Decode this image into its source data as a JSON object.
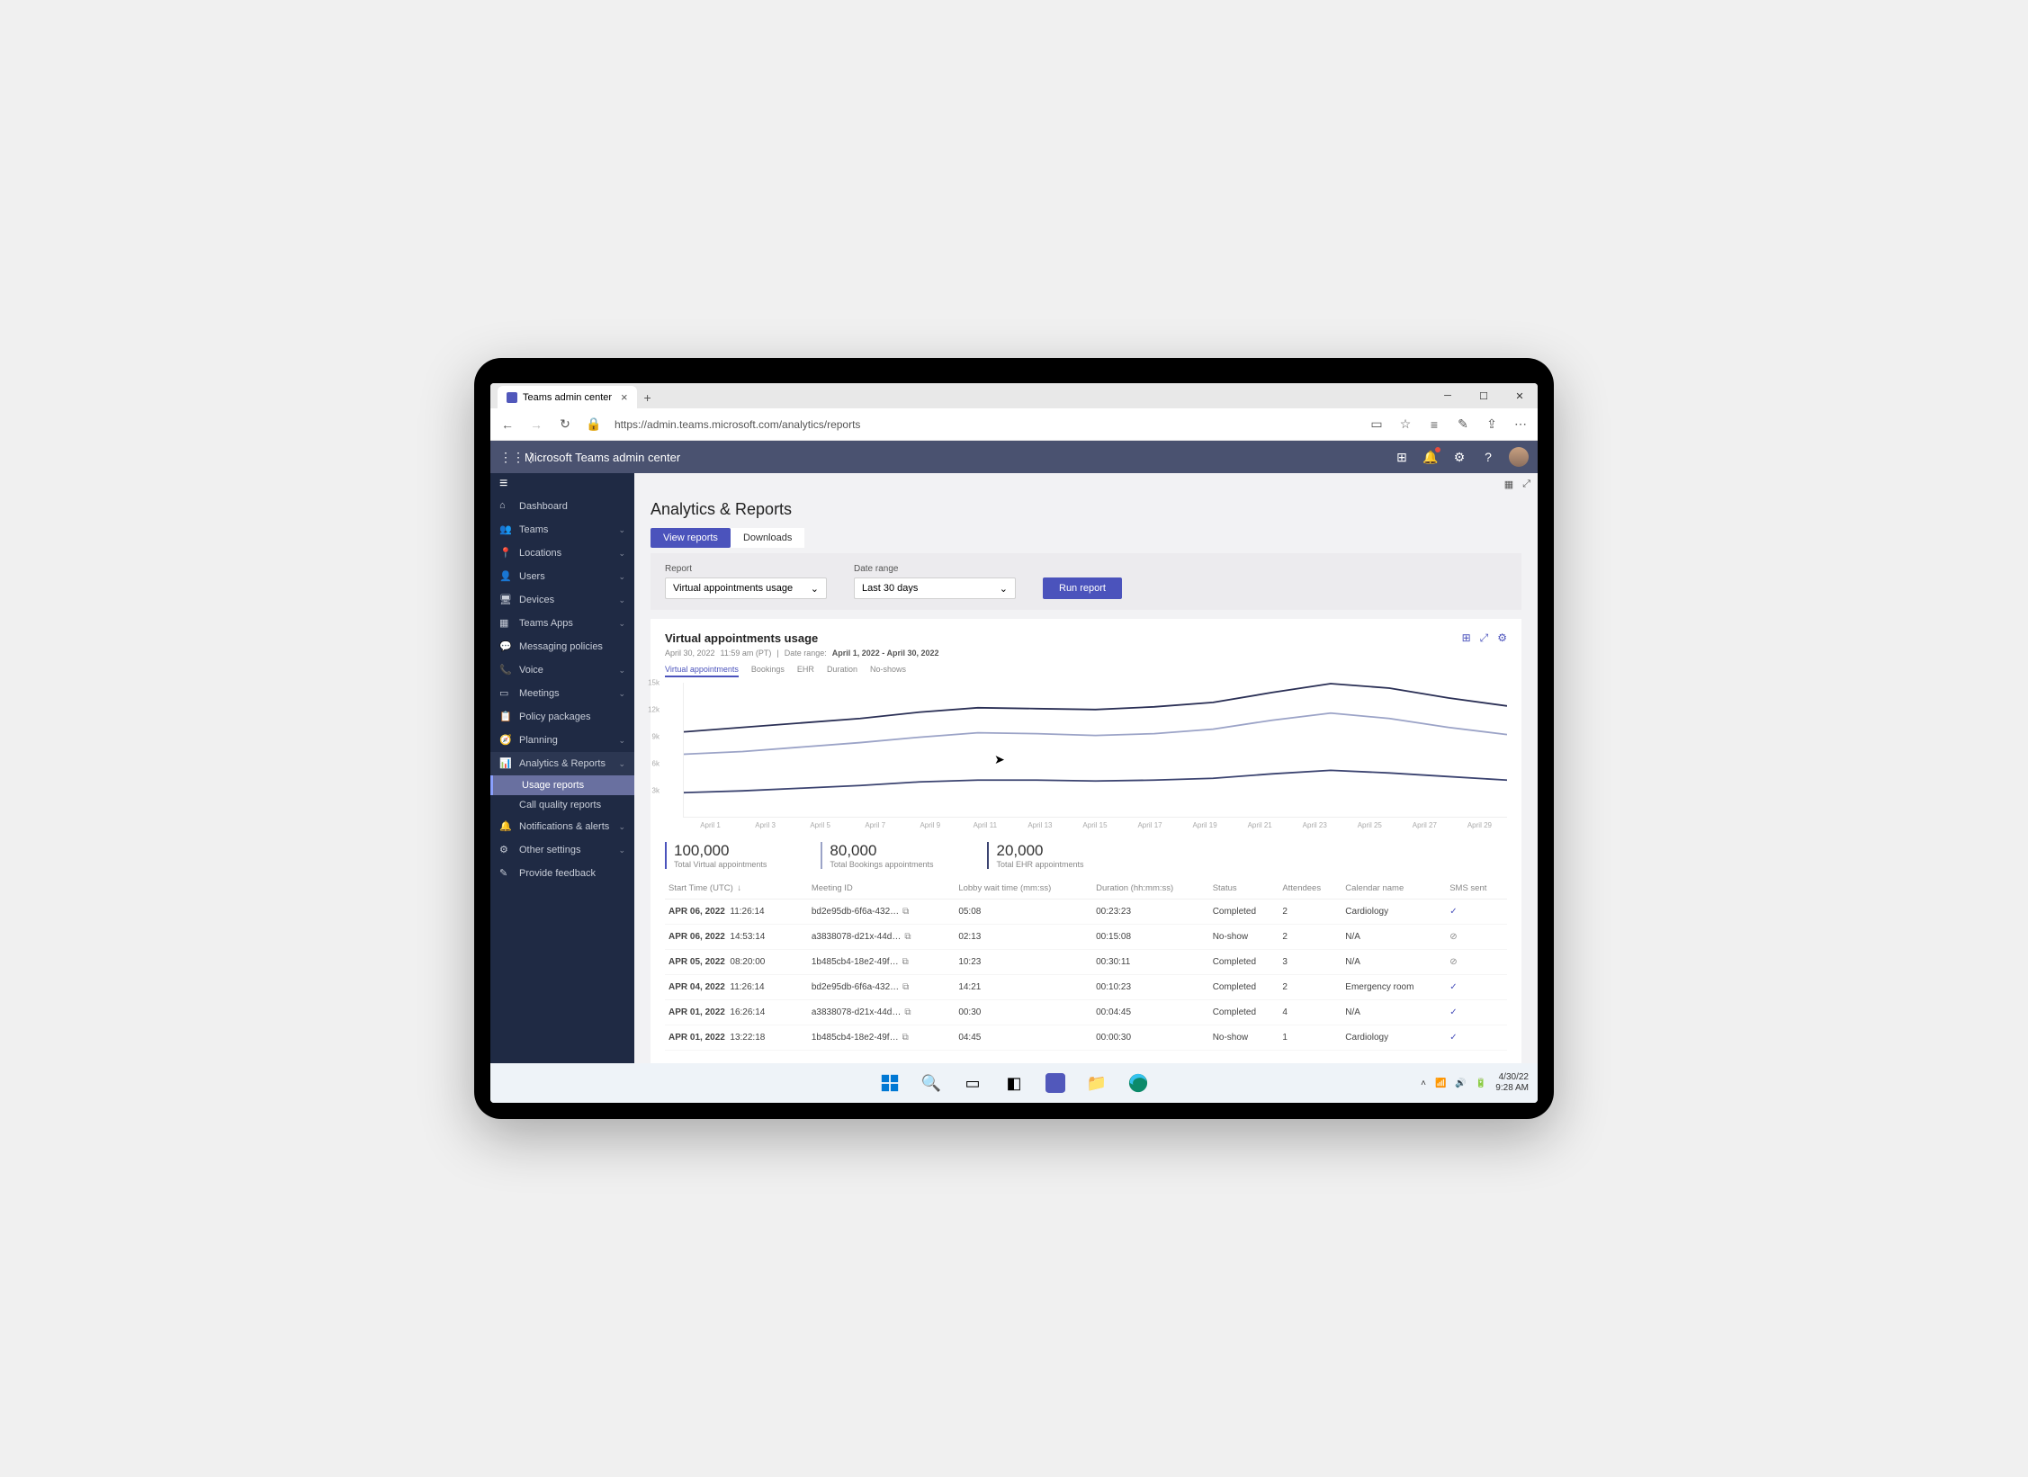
{
  "browser": {
    "tab_title": "Teams admin center",
    "url": "https://admin.teams.microsoft.com/analytics/reports"
  },
  "header": {
    "title": "Microsoft Teams admin center"
  },
  "sidebar": {
    "items": [
      {
        "label": "Dashboard",
        "icon": "home"
      },
      {
        "label": "Teams",
        "icon": "teams",
        "chev": true
      },
      {
        "label": "Locations",
        "icon": "location",
        "chev": true
      },
      {
        "label": "Users",
        "icon": "user",
        "chev": true
      },
      {
        "label": "Devices",
        "icon": "device",
        "chev": true
      },
      {
        "label": "Teams Apps",
        "icon": "apps",
        "chev": true
      },
      {
        "label": "Messaging policies",
        "icon": "message"
      },
      {
        "label": "Voice",
        "icon": "voice",
        "chev": true
      },
      {
        "label": "Meetings",
        "icon": "meeting",
        "chev": true
      },
      {
        "label": "Policy packages",
        "icon": "policy"
      },
      {
        "label": "Planning",
        "icon": "planning",
        "chev": true
      },
      {
        "label": "Analytics & Reports",
        "icon": "analytics",
        "chev": true,
        "expanded": true,
        "subs": [
          {
            "label": "Usage reports",
            "active": true
          },
          {
            "label": "Call quality reports"
          }
        ]
      },
      {
        "label": "Notifications & alerts",
        "icon": "bell",
        "chev": true
      },
      {
        "label": "Other settings",
        "icon": "settings",
        "chev": true
      },
      {
        "label": "Provide feedback",
        "icon": "feedback"
      }
    ]
  },
  "page": {
    "title": "Analytics & Reports",
    "tabs": [
      {
        "label": "View reports",
        "active": true
      },
      {
        "label": "Downloads"
      }
    ],
    "filters": {
      "report_label": "Report",
      "report_value": "Virtual appointments usage",
      "date_label": "Date range",
      "date_value": "Last 30 days",
      "run_label": "Run report"
    },
    "report": {
      "title": "Virtual appointments usage",
      "date": "April 30, 2022",
      "time": "11:59 am (PT)",
      "range_label": "Date range:",
      "range_value": "April 1, 2022 - April 30, 2022",
      "chart_tabs": [
        "Virtual appointments",
        "Bookings",
        "EHR",
        "Duration",
        "No-shows"
      ]
    },
    "totals": [
      {
        "num": "100,000",
        "label": "Total Virtual appointments"
      },
      {
        "num": "80,000",
        "label": "Total Bookings appointments"
      },
      {
        "num": "20,000",
        "label": "Total EHR appointments"
      }
    ],
    "table": {
      "cols": [
        "Start Time (UTC)",
        "Meeting ID",
        "Lobby wait time (mm:ss)",
        "Duration (hh:mm:ss)",
        "Status",
        "Attendees",
        "Calendar name",
        "SMS sent"
      ],
      "rows": [
        {
          "date": "APR 06, 2022",
          "time": "11:26:14",
          "id": "bd2e95db-6f6a-432…",
          "lobby": "05:08",
          "dur": "00:23:23",
          "status": "Completed",
          "att": "2",
          "cal": "Cardiology",
          "sms": "check"
        },
        {
          "date": "APR 06, 2022",
          "time": "14:53:14",
          "id": "a3838078-d21x-44d…",
          "lobby": "02:13",
          "dur": "00:15:08",
          "status": "No-show",
          "att": "2",
          "cal": "N/A",
          "sms": "warn"
        },
        {
          "date": "APR 05, 2022",
          "time": "08:20:00",
          "id": "1b485cb4-18e2-49f…",
          "lobby": "10:23",
          "dur": "00:30:11",
          "status": "Completed",
          "att": "3",
          "cal": "N/A",
          "sms": "warn"
        },
        {
          "date": "APR 04, 2022",
          "time": "11:26:14",
          "id": "bd2e95db-6f6a-432…",
          "lobby": "14:21",
          "dur": "00:10:23",
          "status": "Completed",
          "att": "2",
          "cal": "Emergency room",
          "sms": "check"
        },
        {
          "date": "APR 01, 2022",
          "time": "16:26:14",
          "id": "a3838078-d21x-44d…",
          "lobby": "00:30",
          "dur": "00:04:45",
          "status": "Completed",
          "att": "4",
          "cal": "N/A",
          "sms": "check"
        },
        {
          "date": "APR 01, 2022",
          "time": "13:22:18",
          "id": "1b485cb4-18e2-49f…",
          "lobby": "04:45",
          "dur": "00:00:30",
          "status": "No-show",
          "att": "1",
          "cal": "Cardiology",
          "sms": "check"
        }
      ]
    }
  },
  "taskbar": {
    "date": "4/30/22",
    "time": "9:28 AM"
  },
  "chart_data": {
    "type": "line",
    "ylabel": "",
    "ylim": [
      0,
      15000
    ],
    "y_ticks": [
      "15k",
      "12k",
      "9k",
      "6k",
      "3k"
    ],
    "x": [
      "April 1",
      "April 3",
      "April 5",
      "April 7",
      "April 9",
      "April 11",
      "April 13",
      "April 15",
      "April 17",
      "April 19",
      "April 21",
      "April 23",
      "April 25",
      "April 27",
      "April 29"
    ],
    "series": [
      {
        "name": "Virtual appointments",
        "color": "#2a2f55",
        "values": [
          9500,
          10000,
          10500,
          11000,
          11700,
          12200,
          12100,
          12000,
          12300,
          12800,
          13900,
          14900,
          14400,
          13300,
          12400
        ]
      },
      {
        "name": "Bookings",
        "color": "#9ba3c7",
        "values": [
          7000,
          7300,
          7800,
          8300,
          8900,
          9400,
          9300,
          9100,
          9300,
          9800,
          10800,
          11600,
          11000,
          10000,
          9200
        ]
      },
      {
        "name": "EHR",
        "color": "#3b4370",
        "values": [
          2700,
          2900,
          3200,
          3500,
          3900,
          4100,
          4100,
          4000,
          4100,
          4300,
          4800,
          5200,
          4900,
          4500,
          4100
        ]
      }
    ]
  }
}
